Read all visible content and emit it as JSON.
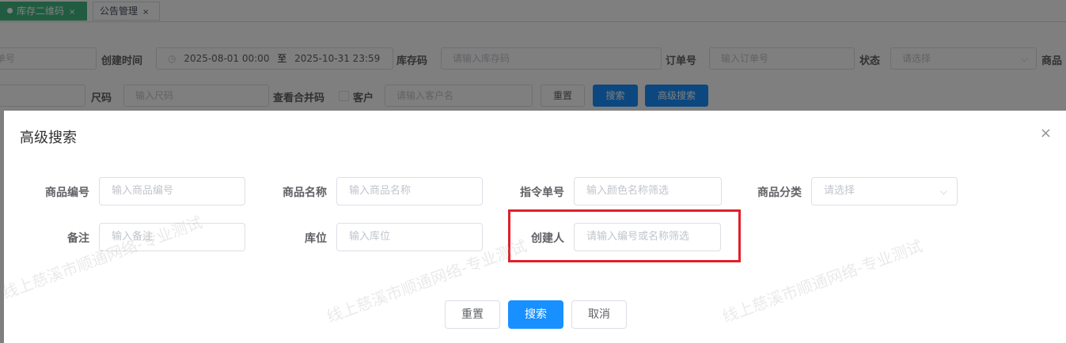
{
  "tabs": [
    {
      "label": "库存二维码",
      "close": "×"
    },
    {
      "label": "公告管理",
      "close": "×"
    }
  ],
  "filters": {
    "row1": {
      "partial_placeholder": "单号",
      "create_time_label": "创建时间",
      "date_start": "2025-08-01 00:00",
      "date_to": "至",
      "date_end": "2025-10-31 23:59",
      "stock_code_label": "库存码",
      "stock_code_placeholder": "请输入库存码",
      "order_no_label": "订单号",
      "order_no_placeholder": "输入订单号",
      "status_label": "状态",
      "status_placeholder": "请选择",
      "goods_label_partial": "商品"
    },
    "row2": {
      "size_label": "尺码",
      "size_placeholder": "输入尺码",
      "merge_label": "查看合并码",
      "customer_label": "客户",
      "customer_placeholder": "请输入客户名",
      "reset": "重置",
      "search": "搜索",
      "advanced": "高级搜索"
    }
  },
  "dialog": {
    "title": "高级搜索",
    "close_icon": "×",
    "fields": {
      "goods_code": {
        "label": "商品编号",
        "placeholder": "输入商品编号"
      },
      "goods_name": {
        "label": "商品名称",
        "placeholder": "输入商品名称"
      },
      "instruction_no": {
        "label": "指令单号",
        "placeholder": "输入颜色名称筛选"
      },
      "goods_category": {
        "label": "商品分类",
        "placeholder": "请选择"
      },
      "remark": {
        "label": "备注",
        "placeholder": "输入备注"
      },
      "location": {
        "label": "库位",
        "placeholder": "输入库位"
      },
      "creator": {
        "label": "创建人",
        "placeholder": "请输入编号或名称筛选"
      }
    },
    "buttons": {
      "reset": "重置",
      "search": "搜索",
      "cancel": "取消"
    }
  },
  "watermark": "线上慈溪市顺通网络-专业测试",
  "colors": {
    "primary": "#1890ff",
    "tab_active": "#42b983",
    "highlight": "#e0202a"
  }
}
